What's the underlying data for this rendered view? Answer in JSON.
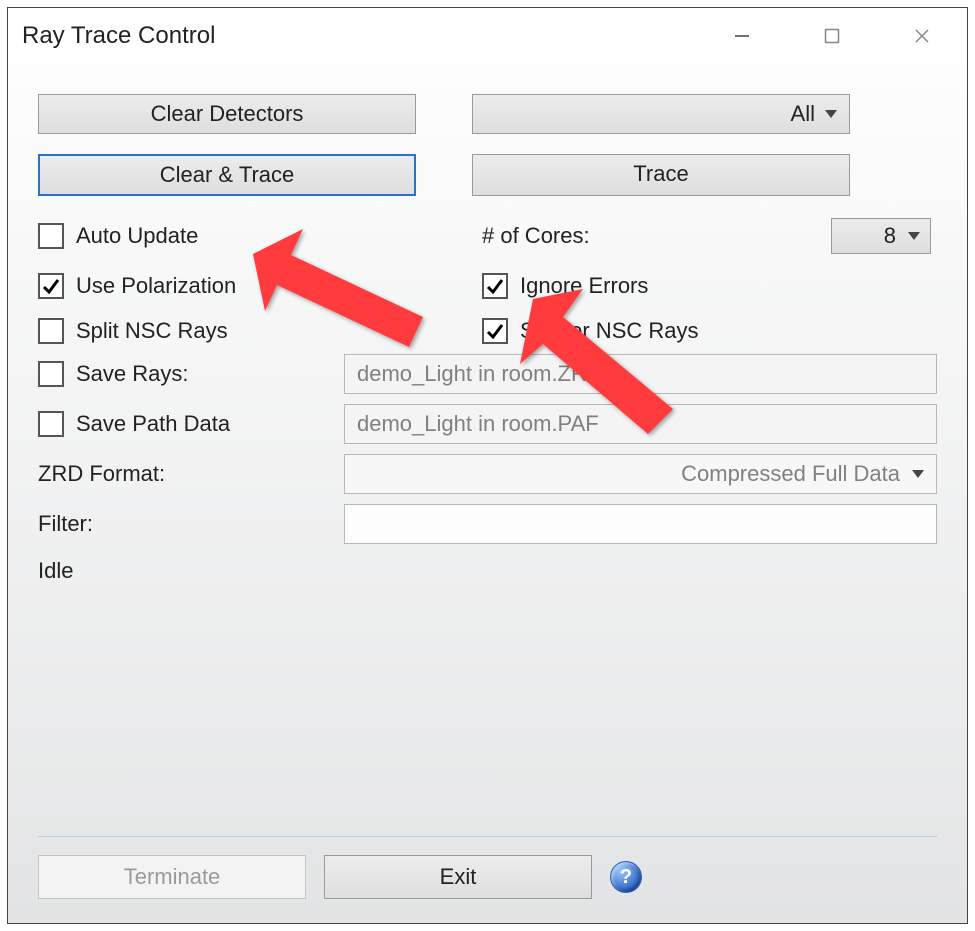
{
  "window": {
    "title": "Ray Trace Control"
  },
  "buttons": {
    "clear_detectors": "Clear Detectors",
    "clear_and_trace": "Clear & Trace",
    "trace": "Trace",
    "all_dropdown": "All"
  },
  "options": {
    "auto_update": {
      "label": "Auto Update",
      "checked": false
    },
    "use_polarization": {
      "label": "Use Polarization",
      "checked": true
    },
    "split_nsc_rays": {
      "label": "Split NSC Rays",
      "checked": false
    },
    "ignore_errors": {
      "label": "Ignore Errors",
      "checked": true
    },
    "scatter_nsc_rays": {
      "label": "Scatter NSC Rays",
      "checked": true
    },
    "save_rays": {
      "label": "Save Rays:",
      "checked": false
    },
    "save_path_data": {
      "label": "Save Path Data",
      "checked": false
    }
  },
  "cores": {
    "label": "# of Cores:",
    "value": "8"
  },
  "fields": {
    "save_rays_file": "demo_Light in room.ZRD",
    "save_path_file": "demo_Light in room.PAF",
    "zrd_format_label": "ZRD Format:",
    "zrd_format_value": "Compressed Full Data",
    "filter_label": "Filter:",
    "filter_value": ""
  },
  "status": "Idle",
  "bottom": {
    "terminate": "Terminate",
    "exit": "Exit",
    "help": "?"
  }
}
